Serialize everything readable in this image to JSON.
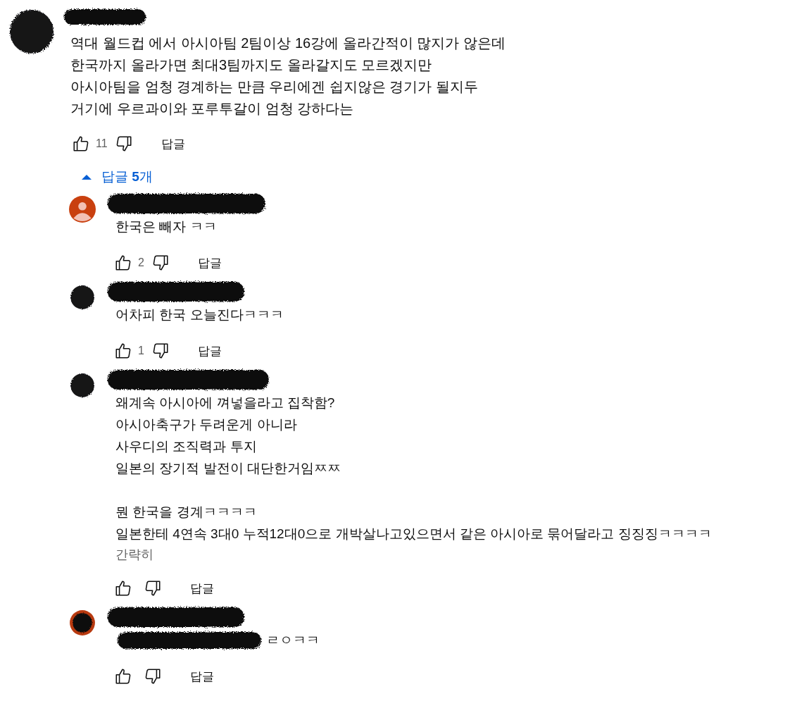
{
  "comment": {
    "avatar": {
      "kind": "redacted"
    },
    "text": "역대 월드컵 에서 아시아팀 2팀이상 16강에 올라간적이 많지가 않은데\n한국까지 올라가면 최대3팀까지도 올라갈지도 모르겠지만\n아시아팀을 엄청 경계하는 만큼 우리에겐 쉽지않은 경기가 될지두\n거기에 우르과이와 포루투갈이 엄청 강하다는",
    "likes": "11",
    "reply_button": "답글"
  },
  "replies_toggle": {
    "label": "답글 **5**개",
    "expanded": true
  },
  "replies": [
    {
      "avatar": {
        "kind": "default"
      },
      "text": "한국은 빼자 ㅋㅋ",
      "likes": "2",
      "reply_button": "답글"
    },
    {
      "avatar": {
        "kind": "redacted"
      },
      "text": "어차피 한국 오늘진다ㅋㅋㅋ",
      "likes": "1",
      "reply_button": "답글"
    },
    {
      "avatar": {
        "kind": "redacted"
      },
      "text": "왜계속 아시아에 껴넣을라고 집착함?\n아시아축구가 두려운게 아니라\n사우디의 조직력과 투지\n일본의 장기적 발전이 대단한거임ㅉㅉ\n\n뭔 한국을 경계ㅋㅋㅋㅋ\n일본한테 4연속 3대0 누적12대0으로 개박살나고있으면서 같은 아시아로 묶어달라고 징징징ㅋㅋㅋㅋ",
      "show_less": "간략히",
      "reply_button": "답글"
    },
    {
      "avatar": {
        "kind": "redacted_ring"
      },
      "redacted_prefix": true,
      "text": "ㄹㅇㅋㅋ",
      "reply_button": "답글"
    }
  ]
}
